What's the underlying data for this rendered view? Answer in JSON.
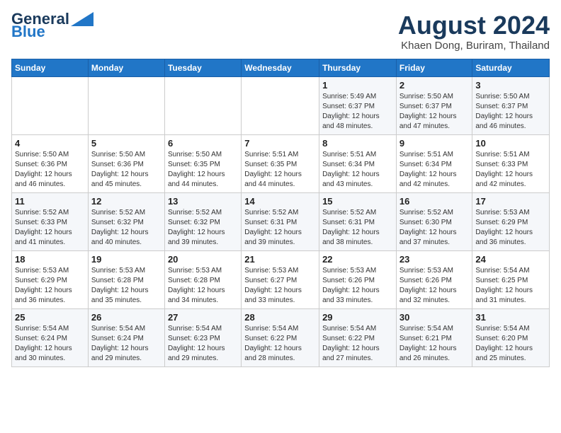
{
  "header": {
    "logo_line1": "General",
    "logo_line2": "Blue",
    "month_year": "August 2024",
    "location": "Khaen Dong, Buriram, Thailand"
  },
  "columns": [
    "Sunday",
    "Monday",
    "Tuesday",
    "Wednesday",
    "Thursday",
    "Friday",
    "Saturday"
  ],
  "weeks": [
    [
      {
        "day": "",
        "info": ""
      },
      {
        "day": "",
        "info": ""
      },
      {
        "day": "",
        "info": ""
      },
      {
        "day": "",
        "info": ""
      },
      {
        "day": "1",
        "info": "Sunrise: 5:49 AM\nSunset: 6:37 PM\nDaylight: 12 hours\nand 48 minutes."
      },
      {
        "day": "2",
        "info": "Sunrise: 5:50 AM\nSunset: 6:37 PM\nDaylight: 12 hours\nand 47 minutes."
      },
      {
        "day": "3",
        "info": "Sunrise: 5:50 AM\nSunset: 6:37 PM\nDaylight: 12 hours\nand 46 minutes."
      }
    ],
    [
      {
        "day": "4",
        "info": "Sunrise: 5:50 AM\nSunset: 6:36 PM\nDaylight: 12 hours\nand 46 minutes."
      },
      {
        "day": "5",
        "info": "Sunrise: 5:50 AM\nSunset: 6:36 PM\nDaylight: 12 hours\nand 45 minutes."
      },
      {
        "day": "6",
        "info": "Sunrise: 5:50 AM\nSunset: 6:35 PM\nDaylight: 12 hours\nand 44 minutes."
      },
      {
        "day": "7",
        "info": "Sunrise: 5:51 AM\nSunset: 6:35 PM\nDaylight: 12 hours\nand 44 minutes."
      },
      {
        "day": "8",
        "info": "Sunrise: 5:51 AM\nSunset: 6:34 PM\nDaylight: 12 hours\nand 43 minutes."
      },
      {
        "day": "9",
        "info": "Sunrise: 5:51 AM\nSunset: 6:34 PM\nDaylight: 12 hours\nand 42 minutes."
      },
      {
        "day": "10",
        "info": "Sunrise: 5:51 AM\nSunset: 6:33 PM\nDaylight: 12 hours\nand 42 minutes."
      }
    ],
    [
      {
        "day": "11",
        "info": "Sunrise: 5:52 AM\nSunset: 6:33 PM\nDaylight: 12 hours\nand 41 minutes."
      },
      {
        "day": "12",
        "info": "Sunrise: 5:52 AM\nSunset: 6:32 PM\nDaylight: 12 hours\nand 40 minutes."
      },
      {
        "day": "13",
        "info": "Sunrise: 5:52 AM\nSunset: 6:32 PM\nDaylight: 12 hours\nand 39 minutes."
      },
      {
        "day": "14",
        "info": "Sunrise: 5:52 AM\nSunset: 6:31 PM\nDaylight: 12 hours\nand 39 minutes."
      },
      {
        "day": "15",
        "info": "Sunrise: 5:52 AM\nSunset: 6:31 PM\nDaylight: 12 hours\nand 38 minutes."
      },
      {
        "day": "16",
        "info": "Sunrise: 5:52 AM\nSunset: 6:30 PM\nDaylight: 12 hours\nand 37 minutes."
      },
      {
        "day": "17",
        "info": "Sunrise: 5:53 AM\nSunset: 6:29 PM\nDaylight: 12 hours\nand 36 minutes."
      }
    ],
    [
      {
        "day": "18",
        "info": "Sunrise: 5:53 AM\nSunset: 6:29 PM\nDaylight: 12 hours\nand 36 minutes."
      },
      {
        "day": "19",
        "info": "Sunrise: 5:53 AM\nSunset: 6:28 PM\nDaylight: 12 hours\nand 35 minutes."
      },
      {
        "day": "20",
        "info": "Sunrise: 5:53 AM\nSunset: 6:28 PM\nDaylight: 12 hours\nand 34 minutes."
      },
      {
        "day": "21",
        "info": "Sunrise: 5:53 AM\nSunset: 6:27 PM\nDaylight: 12 hours\nand 33 minutes."
      },
      {
        "day": "22",
        "info": "Sunrise: 5:53 AM\nSunset: 6:26 PM\nDaylight: 12 hours\nand 33 minutes."
      },
      {
        "day": "23",
        "info": "Sunrise: 5:53 AM\nSunset: 6:26 PM\nDaylight: 12 hours\nand 32 minutes."
      },
      {
        "day": "24",
        "info": "Sunrise: 5:54 AM\nSunset: 6:25 PM\nDaylight: 12 hours\nand 31 minutes."
      }
    ],
    [
      {
        "day": "25",
        "info": "Sunrise: 5:54 AM\nSunset: 6:24 PM\nDaylight: 12 hours\nand 30 minutes."
      },
      {
        "day": "26",
        "info": "Sunrise: 5:54 AM\nSunset: 6:24 PM\nDaylight: 12 hours\nand 29 minutes."
      },
      {
        "day": "27",
        "info": "Sunrise: 5:54 AM\nSunset: 6:23 PM\nDaylight: 12 hours\nand 29 minutes."
      },
      {
        "day": "28",
        "info": "Sunrise: 5:54 AM\nSunset: 6:22 PM\nDaylight: 12 hours\nand 28 minutes."
      },
      {
        "day": "29",
        "info": "Sunrise: 5:54 AM\nSunset: 6:22 PM\nDaylight: 12 hours\nand 27 minutes."
      },
      {
        "day": "30",
        "info": "Sunrise: 5:54 AM\nSunset: 6:21 PM\nDaylight: 12 hours\nand 26 minutes."
      },
      {
        "day": "31",
        "info": "Sunrise: 5:54 AM\nSunset: 6:20 PM\nDaylight: 12 hours\nand 25 minutes."
      }
    ]
  ]
}
